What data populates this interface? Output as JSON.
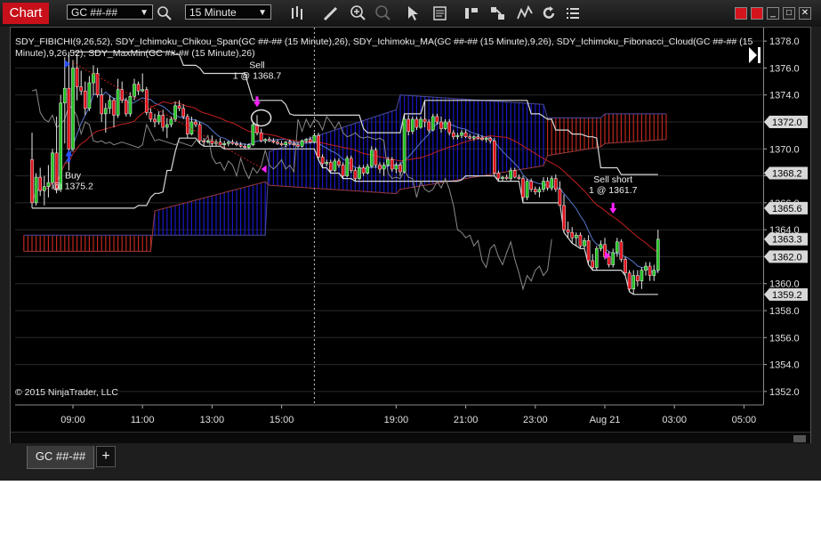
{
  "toolbar": {
    "app_title": "Chart",
    "instrument": "GC ##-##",
    "timeframe": "15 Minute"
  },
  "tabs": [
    {
      "label": "GC ##-##"
    }
  ],
  "tab_add_label": "+",
  "colors": {
    "background": "#000000",
    "bull_candle": "#22c322",
    "bear_candle": "#e0101a",
    "cloud_bull": "#1818c8",
    "cloud_bear": "#c0261c",
    "marker": "#ff22ff",
    "buy_arrow": "#2a50ff"
  },
  "icons": [
    "bar-chart-icon",
    "pencil-icon",
    "zoom-in-icon",
    "zoom-out-icon",
    "pointer-icon",
    "properties-icon",
    "strategy-icon",
    "order-icon",
    "indicator-icon",
    "reload-icon",
    "list-icon"
  ],
  "chart_data": {
    "type": "candlestick",
    "legend": "SDY_FIBICHI(9,26,52), SDY_Ichimoku_Chikou_Span(GC ##-## (15 Minute),26), SDY_Ichimoku_MA(GC ##-## (15 Minute),9,26), SDY_Ichimoku_Fibonacci_Cloud(GC ##-## (15 Minute),9,26,52), SDY_MaxMin(GC ##-## (15 Minute),26)",
    "copyright": "© 2015 NinjaTrader, LLC",
    "x_ticks": [
      "09:00",
      "11:00",
      "13:00",
      "15:00",
      "19:00",
      "21:00",
      "23:00",
      "Aug 21",
      "03:00",
      "05:00"
    ],
    "y_ticks": [
      "1352.0",
      "1354.0",
      "1356.0",
      "1358.0",
      "1360.0",
      "1362.0",
      "1364.0",
      "1366.0",
      "1368.0",
      "1370.0",
      "1372.0",
      "1374.0",
      "1376.0",
      "1378.0"
    ],
    "ylim": [
      1351.0,
      1379.0
    ],
    "price_labels": [
      {
        "value": "1372.0",
        "price": 1372.0
      },
      {
        "value": "1368.2",
        "price": 1368.2
      },
      {
        "value": "1365.6",
        "price": 1365.6
      },
      {
        "value": "1363.3",
        "price": 1363.3
      },
      {
        "value": "1362.0",
        "price": 1362.0
      },
      {
        "value": "1359.2",
        "price": 1359.2
      }
    ],
    "annotations": [
      {
        "text": "Buy",
        "sub": "@ 1375.2",
        "bar": 10,
        "price": 1367.8
      },
      {
        "text": "Sell",
        "sub": "1 @ 1368.7",
        "bar": 55,
        "price": 1376.0
      },
      {
        "text": "Sell short",
        "sub": "1 @ 1361.7",
        "bar": 142,
        "price": 1367.5
      }
    ],
    "candles": [
      [
        1369.2,
        1371.2,
        1365.6,
        1366.0
      ],
      [
        1366.0,
        1368.2,
        1365.8,
        1367.9
      ],
      [
        1367.9,
        1368.6,
        1366.5,
        1366.9
      ],
      [
        1366.9,
        1368.0,
        1365.8,
        1367.2
      ],
      [
        1367.2,
        1368.8,
        1366.4,
        1367.5
      ],
      [
        1367.5,
        1370.0,
        1367.0,
        1369.7
      ],
      [
        1369.7,
        1372.4,
        1366.7,
        1367.0
      ],
      [
        1367.0,
        1374.0,
        1366.8,
        1373.4
      ],
      [
        1373.4,
        1376.8,
        1370.4,
        1374.5
      ],
      [
        1374.5,
        1377.2,
        1368.4,
        1370.0
      ],
      [
        1370.0,
        1376.6,
        1369.8,
        1376.0
      ],
      [
        1376.0,
        1377.0,
        1373.6,
        1374.6
      ],
      [
        1374.6,
        1375.8,
        1374.0,
        1374.3
      ],
      [
        1374.3,
        1375.0,
        1372.5,
        1373.0
      ],
      [
        1373.0,
        1375.4,
        1372.8,
        1374.9
      ],
      [
        1374.9,
        1376.2,
        1374.0,
        1375.6
      ],
      [
        1375.6,
        1376.0,
        1373.8,
        1374.0
      ],
      [
        1374.0,
        1374.5,
        1372.0,
        1372.6
      ],
      [
        1372.6,
        1373.4,
        1371.2,
        1373.0
      ],
      [
        1373.0,
        1374.0,
        1372.6,
        1373.6
      ],
      [
        1373.6,
        1373.8,
        1371.6,
        1372.5
      ],
      [
        1372.5,
        1375.2,
        1372.3,
        1374.4
      ],
      [
        1374.4,
        1375.0,
        1373.4,
        1373.6
      ],
      [
        1373.6,
        1373.8,
        1372.4,
        1372.6
      ],
      [
        1372.6,
        1374.2,
        1372.4,
        1373.9
      ],
      [
        1373.9,
        1375.2,
        1373.6,
        1374.8
      ],
      [
        1374.8,
        1375.0,
        1374.0,
        1374.3
      ],
      [
        1374.3,
        1375.6,
        1374.2,
        1374.4
      ],
      [
        1374.4,
        1374.6,
        1372.5,
        1372.7
      ],
      [
        1372.7,
        1373.0,
        1372.0,
        1372.2
      ],
      [
        1372.2,
        1372.6,
        1371.6,
        1372.0
      ],
      [
        1372.0,
        1372.8,
        1371.8,
        1372.5
      ],
      [
        1372.5,
        1372.9,
        1371.3,
        1371.6
      ],
      [
        1371.6,
        1372.3,
        1370.8,
        1371.8
      ],
      [
        1371.8,
        1372.4,
        1371.6,
        1372.2
      ],
      [
        1372.2,
        1373.5,
        1372.0,
        1373.2
      ],
      [
        1373.2,
        1373.6,
        1372.8,
        1373.0
      ],
      [
        1373.0,
        1373.3,
        1372.2,
        1372.4
      ],
      [
        1372.4,
        1372.6,
        1370.8,
        1371.1
      ],
      [
        1371.1,
        1372.4,
        1371.0,
        1372.0
      ],
      [
        1372.0,
        1372.2,
        1371.6,
        1371.8
      ],
      [
        1371.8,
        1372.0,
        1370.4,
        1370.6
      ],
      [
        1370.6,
        1370.8,
        1370.2,
        1370.5
      ],
      [
        1370.5,
        1370.7,
        1370.4,
        1370.6
      ],
      [
        1370.6,
        1371.0,
        1370.2,
        1370.4
      ],
      [
        1370.4,
        1370.7,
        1370.2,
        1370.5
      ],
      [
        1370.5,
        1370.8,
        1370.2,
        1370.3
      ],
      [
        1370.3,
        1370.6,
        1370.0,
        1370.4
      ],
      [
        1370.4,
        1370.6,
        1370.2,
        1370.5
      ],
      [
        1370.5,
        1370.7,
        1370.3,
        1370.4
      ],
      [
        1370.4,
        1370.6,
        1370.2,
        1370.3
      ],
      [
        1370.3,
        1370.5,
        1370.1,
        1370.2
      ],
      [
        1370.2,
        1370.4,
        1370.0,
        1370.1
      ],
      [
        1370.1,
        1370.4,
        1370.0,
        1370.3
      ],
      [
        1370.3,
        1372.0,
        1370.2,
        1371.8
      ],
      [
        1371.8,
        1372.5,
        1371.0,
        1371.2
      ],
      [
        1371.2,
        1371.5,
        1370.5,
        1370.6
      ],
      [
        1370.6,
        1370.8,
        1370.4,
        1370.7
      ],
      [
        1370.7,
        1370.9,
        1370.5,
        1370.6
      ],
      [
        1370.6,
        1370.8,
        1370.4,
        1370.5
      ],
      [
        1370.5,
        1370.7,
        1370.3,
        1370.4
      ],
      [
        1370.4,
        1370.6,
        1370.2,
        1370.3
      ],
      [
        1370.3,
        1370.6,
        1370.1,
        1370.5
      ],
      [
        1370.5,
        1370.7,
        1370.3,
        1370.4
      ],
      [
        1370.4,
        1370.6,
        1370.2,
        1370.3
      ],
      [
        1370.3,
        1370.5,
        1370.1,
        1370.2
      ],
      [
        1370.2,
        1370.7,
        1370.1,
        1370.6
      ],
      [
        1370.6,
        1370.8,
        1370.4,
        1370.7
      ],
      [
        1370.7,
        1370.9,
        1370.4,
        1370.5
      ],
      [
        1370.5,
        1371.2,
        1370.4,
        1371.0
      ],
      [
        1371.0,
        1371.2,
        1369.2,
        1369.4
      ],
      [
        1369.4,
        1369.6,
        1368.6,
        1368.9
      ],
      [
        1368.9,
        1369.2,
        1368.7,
        1369.0
      ],
      [
        1369.0,
        1369.2,
        1368.2,
        1368.4
      ],
      [
        1368.4,
        1369.3,
        1368.3,
        1369.1
      ],
      [
        1369.1,
        1369.3,
        1368.6,
        1368.8
      ],
      [
        1368.8,
        1369.0,
        1367.8,
        1368.0
      ],
      [
        1368.0,
        1369.5,
        1367.9,
        1369.3
      ],
      [
        1369.3,
        1369.5,
        1368.2,
        1368.4
      ],
      [
        1368.4,
        1368.6,
        1367.6,
        1367.8
      ],
      [
        1367.8,
        1368.8,
        1367.7,
        1368.6
      ],
      [
        1368.6,
        1368.8,
        1368.0,
        1368.2
      ],
      [
        1368.2,
        1368.9,
        1368.1,
        1368.7
      ],
      [
        1368.7,
        1370.2,
        1368.6,
        1369.9
      ],
      [
        1369.9,
        1370.1,
        1368.6,
        1368.8
      ],
      [
        1368.8,
        1369.0,
        1368.2,
        1368.5
      ],
      [
        1368.5,
        1369.0,
        1368.0,
        1368.8
      ],
      [
        1368.8,
        1369.4,
        1368.7,
        1369.2
      ],
      [
        1369.2,
        1369.4,
        1368.3,
        1368.5
      ],
      [
        1368.5,
        1369.0,
        1368.2,
        1368.8
      ],
      [
        1368.8,
        1369.0,
        1368.0,
        1368.3
      ],
      [
        1368.3,
        1372.6,
        1368.2,
        1372.2
      ],
      [
        1372.2,
        1372.5,
        1371.0,
        1371.3
      ],
      [
        1371.3,
        1372.4,
        1371.1,
        1372.2
      ],
      [
        1372.2,
        1372.4,
        1371.4,
        1371.6
      ],
      [
        1371.6,
        1372.4,
        1371.5,
        1372.2
      ],
      [
        1372.2,
        1373.6,
        1371.6,
        1372.0
      ],
      [
        1372.0,
        1372.2,
        1371.2,
        1371.4
      ],
      [
        1371.4,
        1372.6,
        1371.3,
        1372.4
      ],
      [
        1372.4,
        1372.6,
        1371.8,
        1372.0
      ],
      [
        1372.0,
        1372.4,
        1371.2,
        1371.5
      ],
      [
        1371.5,
        1372.2,
        1371.4,
        1372.0
      ],
      [
        1372.0,
        1372.2,
        1371.0,
        1371.2
      ],
      [
        1371.2,
        1371.4,
        1370.7,
        1370.9
      ],
      [
        1370.9,
        1371.2,
        1370.7,
        1371.0
      ],
      [
        1371.0,
        1371.4,
        1370.8,
        1371.2
      ],
      [
        1371.2,
        1371.4,
        1370.8,
        1370.9
      ],
      [
        1370.9,
        1371.1,
        1370.7,
        1370.8
      ],
      [
        1370.8,
        1371.0,
        1370.6,
        1370.9
      ],
      [
        1370.9,
        1371.1,
        1370.7,
        1370.8
      ],
      [
        1370.8,
        1371.0,
        1370.6,
        1370.7
      ],
      [
        1370.7,
        1370.9,
        1370.5,
        1370.8
      ],
      [
        1370.8,
        1370.9,
        1370.4,
        1370.6
      ],
      [
        1370.6,
        1370.8,
        1368.0,
        1368.2
      ],
      [
        1368.2,
        1368.4,
        1367.6,
        1367.8
      ],
      [
        1367.8,
        1368.0,
        1367.6,
        1367.9
      ],
      [
        1367.9,
        1368.1,
        1367.7,
        1367.8
      ],
      [
        1367.8,
        1368.6,
        1367.6,
        1368.4
      ],
      [
        1368.4,
        1368.6,
        1367.8,
        1367.9
      ],
      [
        1367.9,
        1368.1,
        1367.7,
        1367.8
      ],
      [
        1367.8,
        1368.0,
        1366.0,
        1366.4
      ],
      [
        1366.4,
        1367.8,
        1366.2,
        1367.6
      ],
      [
        1367.6,
        1367.8,
        1366.8,
        1367.0
      ],
      [
        1367.0,
        1367.2,
        1366.6,
        1366.8
      ],
      [
        1366.8,
        1367.2,
        1366.4,
        1367.0
      ],
      [
        1367.0,
        1367.9,
        1366.8,
        1367.6
      ],
      [
        1367.6,
        1367.9,
        1366.9,
        1367.1
      ],
      [
        1367.1,
        1368.0,
        1366.9,
        1367.8
      ],
      [
        1367.8,
        1368.1,
        1366.8,
        1367.0
      ],
      [
        1367.0,
        1367.6,
        1366.0,
        1365.8
      ],
      [
        1365.8,
        1366.6,
        1363.8,
        1364.0
      ],
      [
        1364.0,
        1364.6,
        1363.4,
        1363.8
      ],
      [
        1363.8,
        1364.2,
        1363.0,
        1363.4
      ],
      [
        1363.4,
        1363.8,
        1362.8,
        1363.6
      ],
      [
        1363.6,
        1363.8,
        1362.6,
        1362.8
      ],
      [
        1362.8,
        1363.4,
        1362.6,
        1363.2
      ],
      [
        1363.2,
        1363.6,
        1361.4,
        1361.7
      ],
      [
        1361.7,
        1362.2,
        1361.0,
        1361.2
      ],
      [
        1361.2,
        1362.8,
        1361.0,
        1362.6
      ],
      [
        1362.6,
        1363.2,
        1362.4,
        1362.9
      ],
      [
        1362.9,
        1363.4,
        1361.8,
        1362.0
      ],
      [
        1362.0,
        1362.4,
        1361.2,
        1361.4
      ],
      [
        1361.4,
        1362.6,
        1361.2,
        1362.3
      ],
      [
        1362.3,
        1363.4,
        1362.0,
        1363.1
      ],
      [
        1363.1,
        1363.3,
        1361.6,
        1361.8
      ],
      [
        1361.8,
        1362.0,
        1360.6,
        1360.8
      ],
      [
        1360.8,
        1361.0,
        1359.4,
        1359.6
      ],
      [
        1359.6,
        1361.0,
        1359.2,
        1360.6
      ],
      [
        1360.6,
        1361.0,
        1359.8,
        1360.2
      ],
      [
        1360.2,
        1361.2,
        1359.6,
        1361.0
      ],
      [
        1361.0,
        1361.6,
        1360.6,
        1361.3
      ],
      [
        1361.3,
        1361.6,
        1360.2,
        1360.6
      ],
      [
        1360.6,
        1361.4,
        1360.2,
        1361.0
      ],
      [
        1361.0,
        1364.0,
        1360.8,
        1363.3
      ]
    ]
  }
}
